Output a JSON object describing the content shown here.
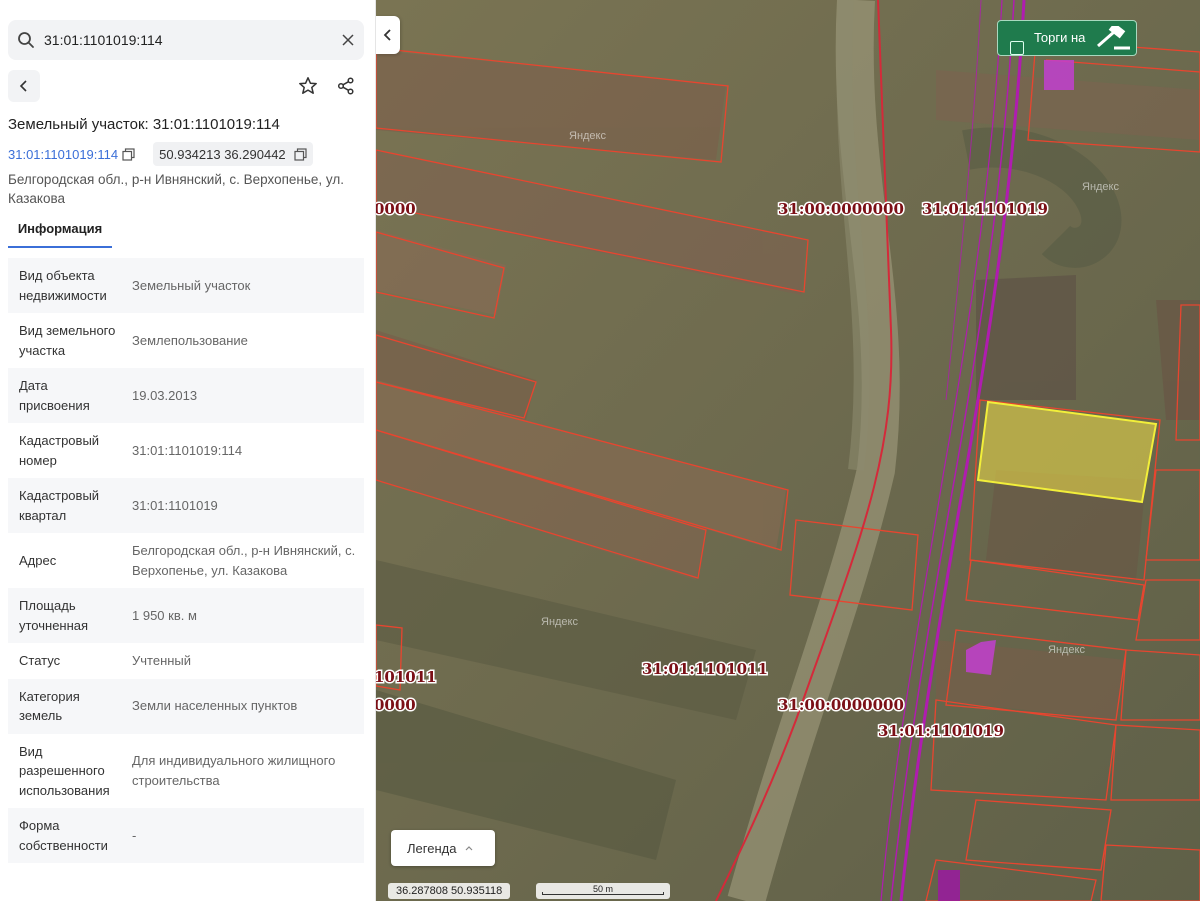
{
  "search": {
    "value": "31:01:1101019:114"
  },
  "card": {
    "title": "Земельный участок: 31:01:1101019:114",
    "cadastral_number": "31:01:1101019:114",
    "coordinates": "50.934213 36.290442",
    "address": "Белгородская обл., р-н Ивнянский, с. Верхопенье, ул. Казакова",
    "tab_info": "Информация"
  },
  "properties": [
    {
      "key": "Вид объекта недвижимости",
      "value": "Земельный участок"
    },
    {
      "key": "Вид земельного участка",
      "value": "Землепользование"
    },
    {
      "key": "Дата присвоения",
      "value": "19.03.2013"
    },
    {
      "key": "Кадастровый номер",
      "value": "31:01:1101019:114"
    },
    {
      "key": "Кадастровый квартал",
      "value": "31:01:1101019"
    },
    {
      "key": "Адрес",
      "value": "Белгородская обл., р-н Ивнянский, с. Верхопенье, ул. Казакова"
    },
    {
      "key": "Площадь уточненная",
      "value": "1 950 кв. м"
    },
    {
      "key": "Статус",
      "value": "Учтенный"
    },
    {
      "key": "Категория земель",
      "value": "Земли населенных пунктов"
    },
    {
      "key": "Вид разрешенного использования",
      "value": "Для индивидуального жилищного строительства"
    },
    {
      "key": "Форма собственности",
      "value": "-"
    }
  ],
  "map": {
    "auction_label": "Торги на",
    "legend_label": "Легенда",
    "cursor_coordinates": "36.287808  50.935118",
    "scale_label": "50 m",
    "watermark": "Яндекс",
    "quarter_labels": {
      "a": "31:00:0000000",
      "b": "31:01:1101019",
      "c": "0000",
      "d": "31:01:1101011",
      "e": "101011",
      "f": "0000",
      "g": "31:00:0000000",
      "h": "31:01:1101019"
    },
    "colors": {
      "parcel_outline": "#e8452f",
      "selected_fill": "#e6d54a",
      "selected_outline": "#f2ef3a",
      "quarter_boundary": "#d42a3a",
      "zone_boundary": "#b01cb0",
      "label_text": "#7b0f16",
      "auction_bg": "#1f7b4d",
      "link": "#3b6fd8"
    }
  }
}
